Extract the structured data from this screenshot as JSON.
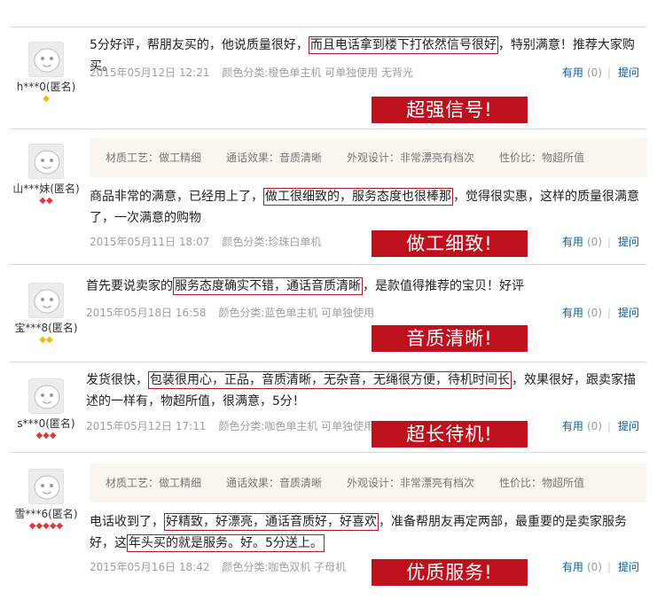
{
  "reviews": [
    {
      "user": "h***0(匿名)",
      "level": "◆",
      "pre": "5分好评，帮朋友买的，他说质量很好，",
      "hl": "而且电话拿到楼下打依然信号很好",
      "post": "，特别满意！推荐大家购买。",
      "date": "2015年05月12日 12:21",
      "variant": "颜色分类:橙色单主机 可单独使用 无背光",
      "useful": "有用",
      "count": "(0)",
      "ask": "提问",
      "banner": "超强信号!"
    },
    {
      "user": "山***妹(匿名)",
      "level": "◆◆",
      "tags": [
        "材质工艺：做工精细",
        "通话效果：音质清晰",
        "外观设计：非常漂亮有档次",
        "性价比：物超所值"
      ],
      "pre": "商品非常的满意，已经用上了，",
      "hl": "做工很细致的，服务态度也很棒那",
      "post": "，觉得很实惠，这样的质量很满意了，一次满意的购物",
      "date": "2015年05月11日 18:07",
      "variant": "颜色分类:珍珠白单机",
      "useful": "有用",
      "count": "(0)",
      "ask": "提问",
      "banner": "做工细致!"
    },
    {
      "user": "宝***8(匿名)",
      "level": "◆◆",
      "pre": "首先要说卖家的",
      "hl": "服务态度确实不错，通话音质清晰",
      "post": "，是款值得推荐的宝贝！好评",
      "date": "2015年05月18日 16:58",
      "variant": "颜色分类:蓝色单主机 可单独使用",
      "useful": "有用",
      "count": "(0)",
      "ask": "提问",
      "banner": "音质清晰!"
    },
    {
      "user": "s***0(匿名)",
      "level": "◆◆◆",
      "pre": "发货很快，",
      "hl": "包装很用心，正品，音质清晰，无杂音，无绳很方便，待机时间长",
      "post": "，效果很好，跟卖家描述的一样有，物超所值，很满意，5分！",
      "date": "2015年05月12日 17:11",
      "variant": "颜色分类:咖色单主机 可单独使用",
      "useful": "有用",
      "count": "(0)",
      "ask": "提问",
      "banner": "超长待机!"
    },
    {
      "user": "雪***6(匿名)",
      "level": "◆◆◆◆◆",
      "tags": [
        "材质工艺：做工精细",
        "通话效果：音质清晰",
        "外观设计：非常漂亮有档次",
        "性价比：物超所值"
      ],
      "pre": "电话收到了，",
      "hl": "好精致，好漂亮，通话音质好，好喜欢",
      "post": "，准备帮朋友再定两部，最重要的是卖家服务好，这",
      "hl2": "年头买的就是服务。好。5分送上。",
      "date": "2015年05月16日 18:42",
      "variant": "颜色分类:咖色双机 子母机",
      "useful": "有用",
      "count": "(0)",
      "ask": "提问",
      "banner": "优质服务!"
    }
  ],
  "colors": {
    "highlight": "#b21b26",
    "banner": "#bf111d",
    "link": "#005ea7"
  }
}
